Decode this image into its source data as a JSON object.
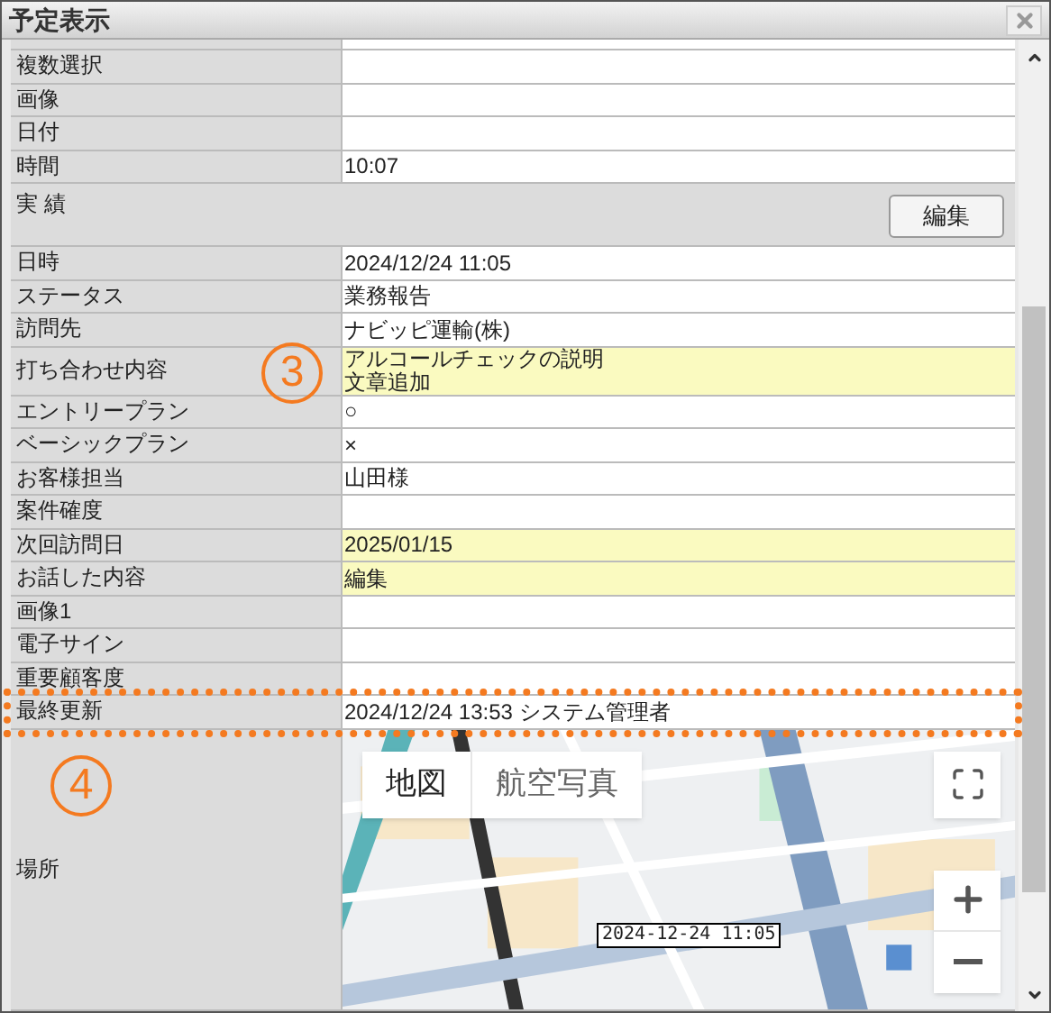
{
  "window": {
    "title": "予定表示"
  },
  "rows": [
    {
      "kind": "field",
      "label": "複数選択",
      "highlighted": false
    },
    {
      "kind": "field",
      "label": "画像",
      "highlighted": false
    },
    {
      "kind": "field",
      "label": "日付",
      "highlighted": false
    },
    {
      "kind": "field",
      "label": "時間",
      "value": "10:07",
      "highlighted": false
    },
    {
      "kind": "section",
      "label": "実 績",
      "button": "編集"
    },
    {
      "kind": "field",
      "label": "日時",
      "value": "2024/12/24 11:05",
      "highlighted": false
    },
    {
      "kind": "field",
      "label": "ステータス",
      "value": "業務報告",
      "highlighted": false
    },
    {
      "kind": "field",
      "label": "訪問先",
      "value": "ナビッピ運輸(株)",
      "highlighted": false
    },
    {
      "kind": "field",
      "label": "打ち合わせ内容",
      "value_lines": [
        "アルコールチェックの説明",
        "文章追加"
      ],
      "highlighted": true,
      "annotation": "3"
    },
    {
      "kind": "field",
      "label": "エントリープラン",
      "value": "○",
      "highlighted": false
    },
    {
      "kind": "field",
      "label": "ベーシックプラン",
      "value": "×",
      "highlighted": false
    },
    {
      "kind": "field",
      "label": "お客様担当",
      "value": "山田様",
      "highlighted": false
    },
    {
      "kind": "field",
      "label": "案件確度",
      "highlighted": false
    },
    {
      "kind": "field",
      "label": "次回訪問日",
      "value": "2025/01/15",
      "highlighted": true
    },
    {
      "kind": "field",
      "label": "お話した内容",
      "value": "編集",
      "highlighted": true
    },
    {
      "kind": "field",
      "label": "画像1",
      "highlighted": false
    },
    {
      "kind": "field",
      "label": "電子サイン",
      "highlighted": false
    },
    {
      "kind": "field",
      "label": "重要顧客度",
      "highlighted": false
    },
    {
      "kind": "field",
      "label": "最終更新",
      "value": "2024/12/24 13:53 システム管理者",
      "highlighted": false,
      "outlined": true
    },
    {
      "kind": "map",
      "label": "場所",
      "annotation": "4",
      "map_types": [
        {
          "label": "地図",
          "selected": true
        },
        {
          "label": "航空写真",
          "selected": false
        }
      ],
      "marker_label": "2024-12-24 11:05"
    }
  ]
}
